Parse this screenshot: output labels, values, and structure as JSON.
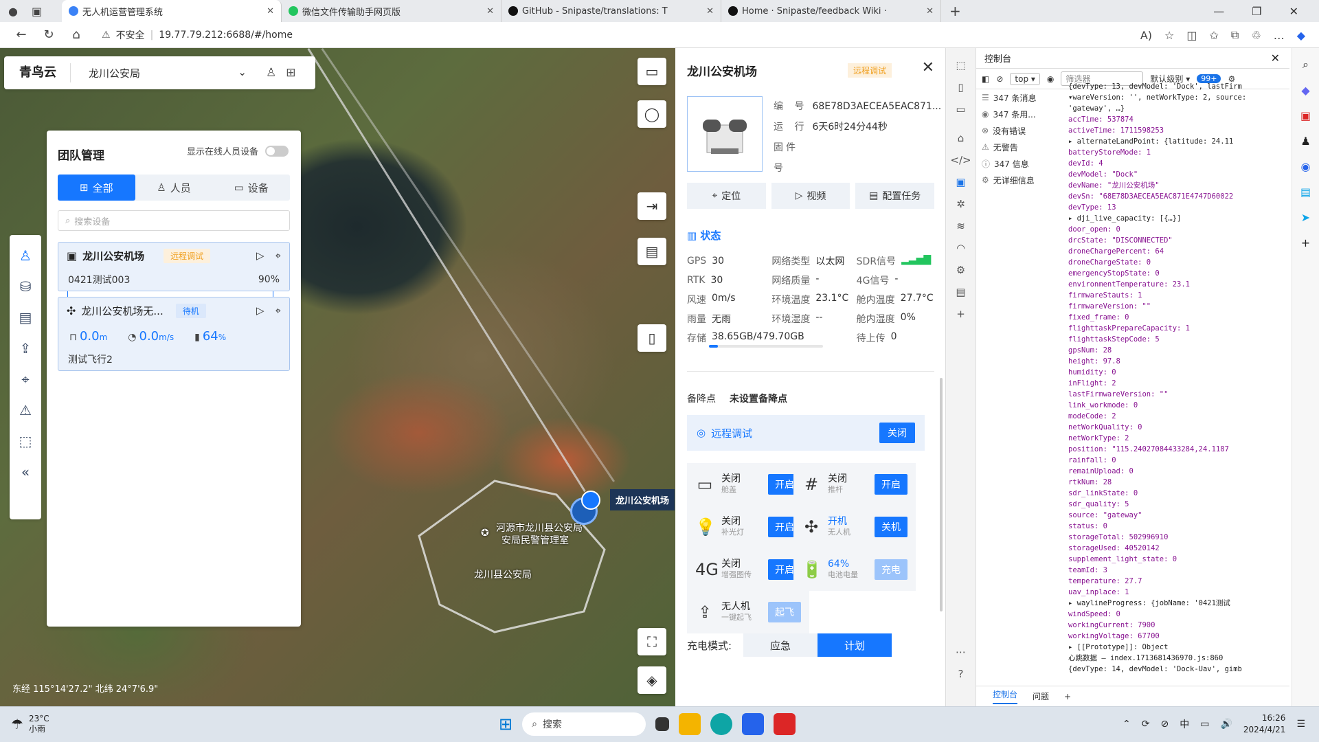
{
  "browser": {
    "tabs": [
      {
        "title": "无人机运营管理系统",
        "active": true,
        "fav_color": "#3b82f6"
      },
      {
        "title": "微信文件传输助手网页版",
        "active": false,
        "fav_color": "#22c55e"
      },
      {
        "title": "GitHub - Snipaste/translations: T",
        "active": false,
        "fav_color": "#111111"
      },
      {
        "title": "Home · Snipaste/feedback Wiki ·",
        "active": false,
        "fav_color": "#111111"
      }
    ],
    "insecure_label": "不安全",
    "url": "19.77.79.212:6688/#/home"
  },
  "topbar": {
    "logo": "青鸟云",
    "org": "龙川公安局"
  },
  "team": {
    "title": "团队管理",
    "online_label": "显示在线人员设备",
    "tabs": [
      "全部",
      "人员",
      "设备"
    ],
    "search_placeholder": "搜索设备",
    "card1": {
      "name": "龙川公安机场",
      "badge": "远程调试",
      "task": "0421测试003",
      "progress": "90%"
    },
    "card2": {
      "name": "龙川公安机场无...",
      "badge": "待机",
      "height": "0.0",
      "height_unit": "m",
      "speed": "0.0",
      "speed_unit": "m/s",
      "battery": "64",
      "battery_unit": "%",
      "task": "测试飞行2"
    }
  },
  "map": {
    "coord": "东经 115°14'27.2\" 北纬 24°7'6.9\"",
    "dock_label": "龙川公安机场",
    "poi1": "河源市龙川县公安局",
    "poi1_b": "安局民警管理室",
    "poi2": "龙川县公安局"
  },
  "detail": {
    "title": "龙川公安机场",
    "badge": "远程调试",
    "sn_label": "编 号",
    "sn": "68E78D3AECEA5EAC871...",
    "run_label": "运 行",
    "run": "6天6时24分44秒",
    "fw_label": "固件号",
    "btn_locate": "定位",
    "btn_video": "视频",
    "btn_task": "配置任务",
    "status_title": "状态",
    "status": [
      [
        [
          "GPS",
          "30"
        ],
        [
          "网络类型",
          "以太网"
        ],
        [
          "SDR信号",
          ""
        ]
      ],
      [
        [
          "RTK",
          "30"
        ],
        [
          "网络质量",
          "-"
        ],
        [
          "4G信号",
          "-"
        ]
      ],
      [
        [
          "风速",
          "0m/s"
        ],
        [
          "环境温度",
          "23.1°C"
        ],
        [
          "舱内温度",
          "27.7°C"
        ]
      ],
      [
        [
          "雨量",
          "无雨"
        ],
        [
          "环境湿度",
          "--"
        ],
        [
          "舱内湿度",
          "0%"
        ]
      ],
      [
        [
          "存储",
          "38.65GB/479.70GB"
        ],
        [
          "",
          ""
        ],
        [
          "待上传",
          "0"
        ]
      ]
    ],
    "backup_label": "备降点",
    "backup_value": "未设置备降点",
    "remote_label": "远程调试",
    "remote_btn": "关闭",
    "controls": [
      {
        "icon": "▭",
        "state": "关闭",
        "name": "舱盖",
        "btn": "开启",
        "blue": false
      },
      {
        "icon": "#",
        "state": "关闭",
        "name": "推杆",
        "btn": "开启",
        "blue": false
      },
      {
        "icon": "💡",
        "state": "关闭",
        "name": "补光灯",
        "btn": "开启",
        "blue": false
      },
      {
        "icon": "✣",
        "state": "开机",
        "name": "无人机",
        "btn": "关机",
        "blue": true
      },
      {
        "icon": "4G",
        "state": "关闭",
        "name": "增强图传",
        "btn": "开启",
        "blue": false
      },
      {
        "icon": "🔋",
        "state": "64%",
        "name": "电池电量",
        "btn": "充电",
        "blue": true
      },
      {
        "icon": "⇪",
        "state": "无人机",
        "name": "一键起飞",
        "btn": "起飞",
        "blue": false
      }
    ],
    "charge_label": "充电模式:",
    "charge_opts": [
      "应急",
      "计划"
    ]
  },
  "devtools": {
    "title": "控制台",
    "context": "top",
    "filter_placeholder": "筛选器",
    "level": "默认级别",
    "count": "99+",
    "left": [
      {
        "icon": "☰",
        "text": "347 条消息"
      },
      {
        "icon": "◉",
        "text": "347 条用..."
      },
      {
        "icon": "⊗",
        "text": "没有错误"
      },
      {
        "icon": "⚠",
        "text": "无警告"
      },
      {
        "icon": "ⓘ",
        "text": "347 信息"
      },
      {
        "icon": "⚙",
        "text": "无详细信息"
      }
    ],
    "code": [
      "{devType: 13, devModel: 'Dock', lastFirm",
      "▾wareVersion: '', netWorkType: 2, source:",
      "  'gateway', …}",
      "   accTime: 537874",
      "   activeTime: 1711598253",
      " ▸ alternateLandPoint: {latitude: 24.11",
      "   batteryStoreMode: 1",
      "   devId: 4",
      "   devModel: \"Dock\"",
      "   devName: \"龙川公安机场\"",
      "   devSn: \"68E78D3AECEA5EAC871E4747D60022",
      "   devType: 13",
      " ▸ dji_live_capacity: [{…}]",
      "   door_open: 0",
      "   drcState: \"DISCONNECTED\"",
      "   droneChargePercent: 64",
      "   droneChargeState: 0",
      "   emergencyStopState: 0",
      "   environmentTemperature: 23.1",
      "   firmwareStauts: 1",
      "   firmwareVersion: \"\"",
      "   fixed_frame: 0",
      "   flighttaskPrepareCapacity: 1",
      "   flighttaskStepCode: 5",
      "   gpsNum: 28",
      "   height: 97.8",
      "   humidity: 0",
      "   inFlight: 2",
      "   lastFirmwareVersion: \"\"",
      "   link_workmode: 0",
      "   modeCode: 2",
      "   netWorkQuality: 0",
      "   netWorkType: 2",
      "   position: \"115.24027084433284,24.1187",
      "   rainfall: 0",
      "   remainUpload: 0",
      "   rtkNum: 28",
      "   sdr_linkState: 0",
      "   sdr_quality: 5",
      "   source: \"gateway\"",
      "   status: 0",
      "   storageTotal: 502996910",
      "   storageUsed: 40520142",
      "   supplement_light_state: 0",
      "   teamId: 3",
      "   temperature: 27.7",
      "   uav_inplace: 1",
      " ▸ waylineProgress: {jobName: '0421测试",
      "   windSpeed: 0",
      "   workingCurrent: 7900",
      "   workingVoltage: 67700",
      " ▸ [[Prototype]]: Object",
      "心跳数据 –           index.1713681436970.js:860",
      "  {devType: 14, devModel: 'Dock-Uav', gimb"
    ],
    "bottom_tabs": [
      "控制台",
      "问题"
    ]
  },
  "taskbar": {
    "temp": "23°C",
    "weather": "小雨",
    "search": "搜索",
    "ime": "中",
    "time": "16:26",
    "date": "2024/4/21"
  }
}
